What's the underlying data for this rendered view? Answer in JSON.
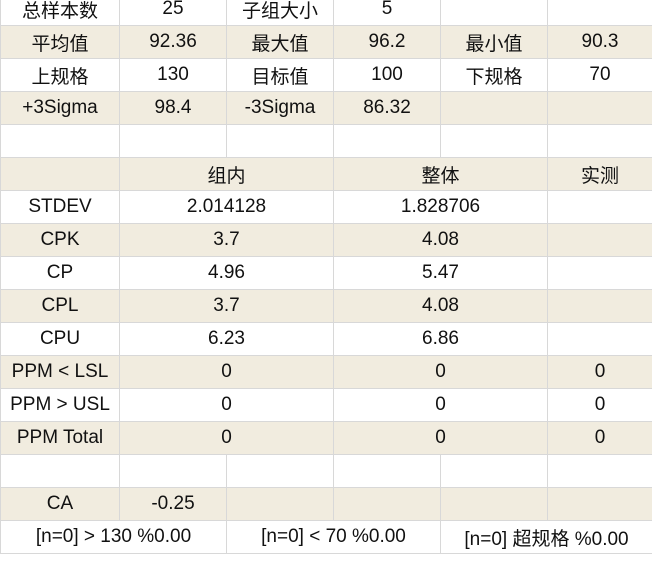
{
  "summary": {
    "rows": [
      [
        "总样本数",
        "25",
        "子组大小",
        "5",
        "",
        ""
      ],
      [
        "平均值",
        "92.36",
        "最大值",
        "96.2",
        "最小值",
        "90.3"
      ],
      [
        "上规格",
        "130",
        "目标值",
        "100",
        "下规格",
        "70"
      ],
      [
        "+3Sigma",
        "98.4",
        "-3Sigma",
        "86.32",
        "",
        ""
      ]
    ]
  },
  "capability": {
    "headers": [
      "",
      "组内",
      "整体",
      "实测"
    ],
    "rows": [
      [
        "STDEV",
        "2.014128",
        "1.828706",
        ""
      ],
      [
        "CPK",
        "3.7",
        "4.08",
        ""
      ],
      [
        "CP",
        "4.96",
        "5.47",
        ""
      ],
      [
        "CPL",
        "3.7",
        "4.08",
        ""
      ],
      [
        "CPU",
        "6.23",
        "6.86",
        ""
      ],
      [
        "PPM < LSL",
        "0",
        "0",
        "0"
      ],
      [
        "PPM > USL",
        "0",
        "0",
        "0"
      ],
      [
        "PPM Total",
        "0",
        "0",
        "0"
      ]
    ]
  },
  "ca": {
    "label": "CA",
    "value": "-0.25"
  },
  "footer": {
    "cells": [
      "[n=0] > 130  %0.00",
      "[n=0] < 70  %0.00",
      "[n=0] 超规格  %0.00"
    ]
  },
  "colors": {
    "label_blue": "#1f5fbf",
    "shade": "#f1ecdf",
    "grid": "#d8d8d8"
  }
}
